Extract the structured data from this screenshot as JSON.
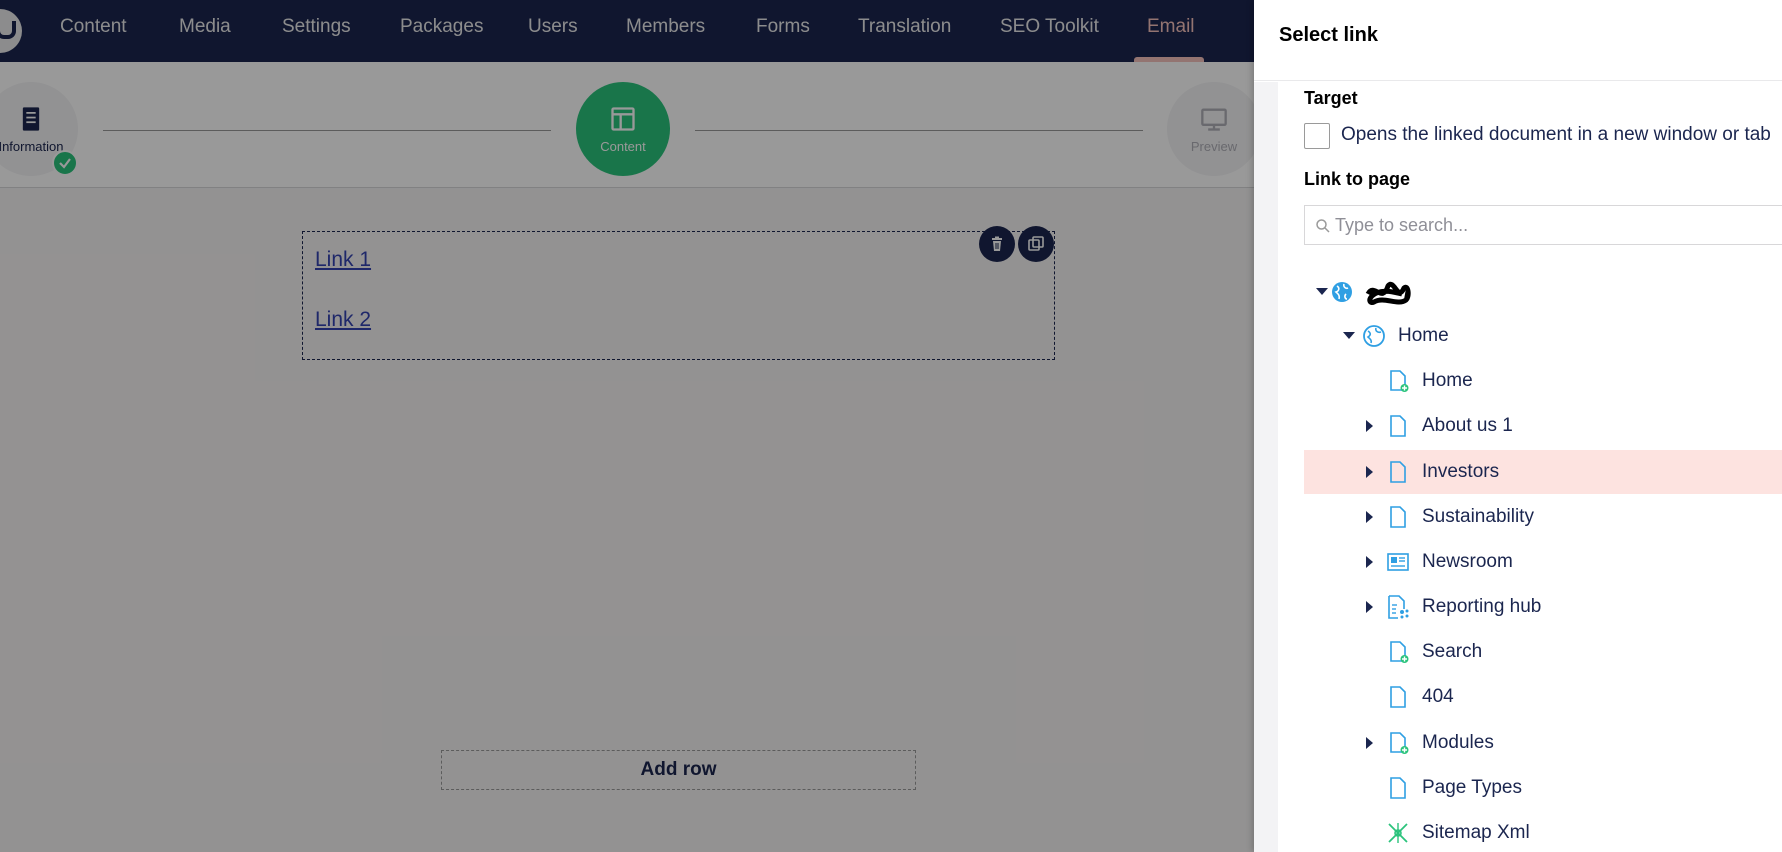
{
  "topnav": {
    "items": [
      {
        "label": "Content"
      },
      {
        "label": "Media"
      },
      {
        "label": "Settings"
      },
      {
        "label": "Packages"
      },
      {
        "label": "Users"
      },
      {
        "label": "Members"
      },
      {
        "label": "Forms"
      },
      {
        "label": "Translation"
      },
      {
        "label": "SEO Toolkit"
      },
      {
        "label": "Email",
        "active": true
      }
    ]
  },
  "stepper": {
    "steps": [
      {
        "label": "Information",
        "icon": "document-icon",
        "completed": true
      },
      {
        "label": "Content",
        "icon": "layout-icon",
        "active": true
      },
      {
        "label": "Preview",
        "icon": "monitor-icon"
      }
    ]
  },
  "editor": {
    "links": [
      "Link 1",
      "Link 2 "
    ],
    "add_row_label": "Add row",
    "actions": [
      "trash-icon",
      "copy-icon"
    ]
  },
  "panel": {
    "title": "Select link",
    "target_label": "Target",
    "new_window_label": "Opens the linked document in a new window or tab",
    "new_window_checked": false,
    "link_to_page_label": "Link to page",
    "search_placeholder": "Type to search...",
    "tree": [
      {
        "label": "",
        "icon": "globe-icon",
        "level": 0,
        "expanded": true,
        "redacted": true
      },
      {
        "label": "Home",
        "icon": "globe-icon",
        "level": 1,
        "expanded": true
      },
      {
        "label": "Home",
        "icon": "document-plus-icon",
        "level": 2
      },
      {
        "label": "About us 1",
        "icon": "document-icon",
        "level": 2,
        "has_children": true
      },
      {
        "label": "Investors",
        "icon": "document-icon",
        "level": 2,
        "has_children": true,
        "selected": true
      },
      {
        "label": "Sustainability",
        "icon": "document-icon",
        "level": 2,
        "has_children": true
      },
      {
        "label": "Newsroom",
        "icon": "newspaper-icon",
        "level": 2,
        "has_children": true
      },
      {
        "label": "Reporting hub",
        "icon": "report-icon",
        "level": 2,
        "has_children": true
      },
      {
        "label": "Search",
        "icon": "document-plus-icon",
        "level": 2
      },
      {
        "label": "404",
        "icon": "document-icon",
        "level": 2
      },
      {
        "label": "Modules",
        "icon": "document-plus-icon",
        "level": 2,
        "has_children": true
      },
      {
        "label": "Page Types",
        "icon": "document-icon",
        "level": 2
      },
      {
        "label": "Sitemap Xml",
        "icon": "sitemap-icon",
        "level": 2
      }
    ]
  },
  "colors": {
    "navbar": "#1b264f",
    "accent_green": "#2bc37c",
    "active_nav": "#f5c1bc",
    "selected_row": "#fde3e0",
    "icon_blue": "#2f9fe3"
  }
}
